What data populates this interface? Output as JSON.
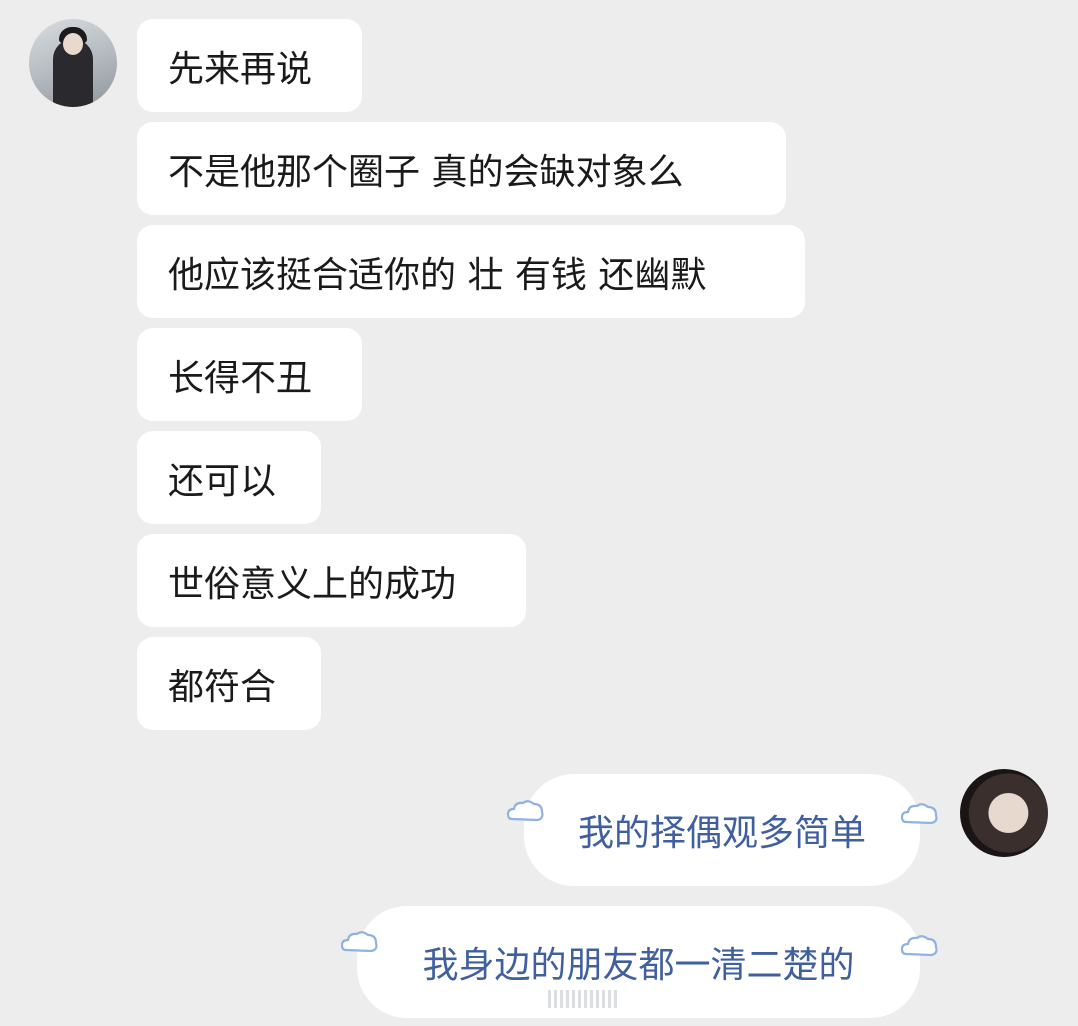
{
  "chat": {
    "left_messages": [
      "先来再说",
      "不是他那个圈子 真的会缺对象么",
      "他应该挺合适你的 壮 有钱 还幽默",
      "长得不丑",
      "还可以",
      "世俗意义上的成功",
      "都符合"
    ],
    "right_messages": [
      "我的择偶观多简单",
      "我身边的朋友都一清二楚的"
    ]
  },
  "colors": {
    "background": "#ededed",
    "bubble": "#ffffff",
    "right_text": "#3f5f9f"
  }
}
